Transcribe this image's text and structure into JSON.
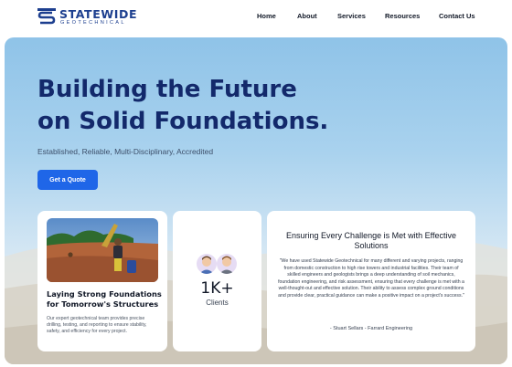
{
  "header": {
    "brand_name": "STATEWIDE",
    "brand_sub": "GEOTECHNICAL",
    "logo_icon": "engineering-logo-icon",
    "nav": [
      {
        "label": "Home"
      },
      {
        "label": "About"
      },
      {
        "label": "Services"
      },
      {
        "label": "Resources"
      },
      {
        "label": "Contact Us"
      }
    ]
  },
  "hero": {
    "title_line1": "Building the Future",
    "title_line2": "on Solid  Foundations.",
    "tagline": "Established, Reliable, Multi-Disciplinary, Accredited",
    "cta_label": "Get a Quote"
  },
  "cards": {
    "feature": {
      "image_icon": "drilling-worker-photo",
      "title": "Laying Strong Foundations for Tomorrow's Structures",
      "body": "Our expert geotechnical team provides precise drilling, testing, and reporting to ensure stability, safety, and efficiency for every project."
    },
    "stats": {
      "avatar_icons": [
        "avatar-man-icon",
        "avatar-man-icon"
      ],
      "value": "1K+",
      "label": "Clients"
    },
    "testimonial": {
      "title": "Ensuring Every Challenge is Met with Effective Solutions",
      "quote": "\"We have used Statewide Geotechnical for many different and varying projects, ranging from domestic construction to high rise towers and industrial facilities.  Their team of skilled engineers and geologists brings a deep understanding of soil mechanics, foundation engineering, and risk assessment, ensuring that every challenge is met with a well-thought-out and effective solution.  Their ability to assess complex ground conditions and provide clear, practical guidance can make a positive impact on a project's success.\"",
      "author": "- Stuart Sellars - Farrard Engineering"
    }
  },
  "colors": {
    "brand": "#1d3f8f",
    "heading": "#13296b",
    "accent": "#1f66e8"
  }
}
